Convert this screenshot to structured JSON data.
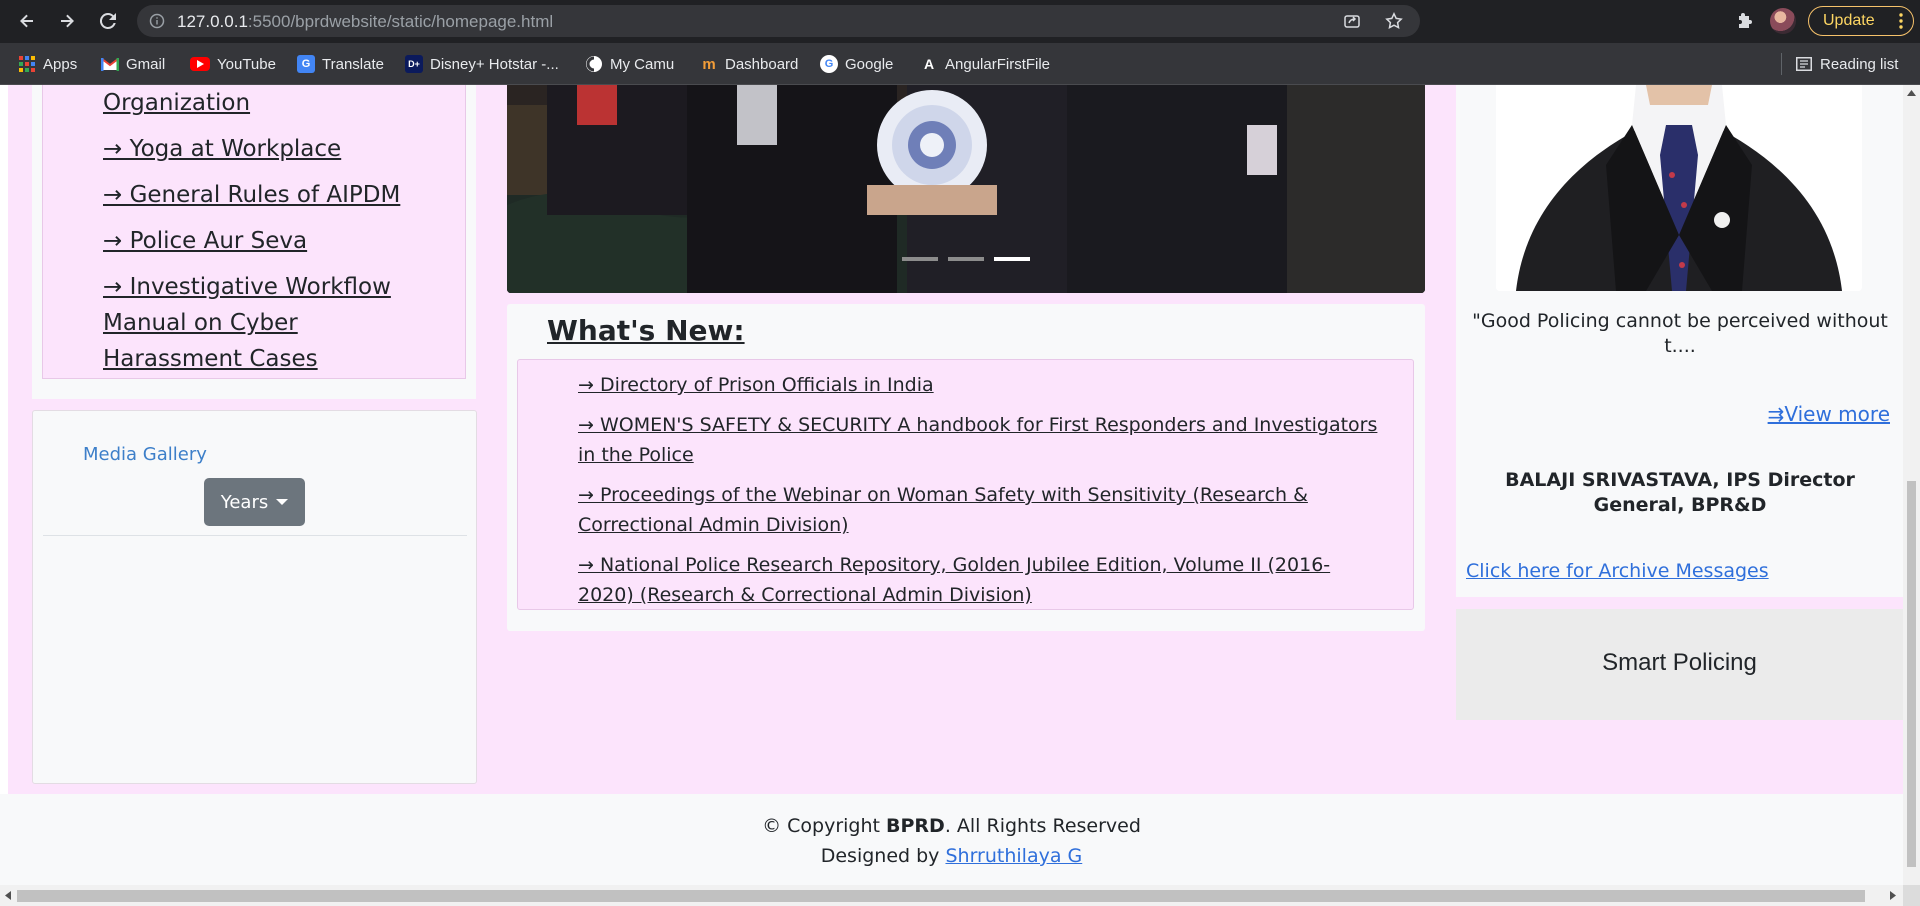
{
  "browser": {
    "url_host": "127.0.0.1",
    "url_rest": ":5500/bprdwebsite/static/homepage.html",
    "update_label": "Update",
    "bookmarks": [
      {
        "label": "Apps",
        "icon": "apps-grid-icon"
      },
      {
        "label": "Gmail",
        "icon": "gmail-icon"
      },
      {
        "label": "YouTube",
        "icon": "youtube-icon"
      },
      {
        "label": "Translate",
        "icon": "translate-icon"
      },
      {
        "label": "Disney+ Hotstar -...",
        "icon": "hotstar-icon"
      },
      {
        "label": "My Camu",
        "icon": "camu-icon"
      },
      {
        "label": "Dashboard",
        "icon": "dashboard-icon"
      },
      {
        "label": "Google",
        "icon": "google-icon"
      },
      {
        "label": "AngularFirstFile",
        "icon": "angular-icon"
      }
    ],
    "reading_list": "Reading list"
  },
  "left_links": [
    "Organization",
    "→ Yoga at Workplace",
    "→ General Rules of AIPDM",
    "→ Police Aur Seva",
    "→ Investigative Workflow Manual on Cyber Harassment Cases"
  ],
  "media": {
    "title": "Media Gallery",
    "years_label": "Years"
  },
  "whats_new": {
    "title": "What's New:",
    "items": [
      "→ Directory of Prison Officials in India",
      "→ WOMEN'S SAFETY & SECURITY A handbook for First Responders and Investigators in the Police",
      "→ Proceedings of the Webinar on Woman Safety with Sensitivity (Research & Correctional Admin Division)",
      "→ National Police Research Repository, Golden Jubilee Edition, Volume II (2016-2020) (Research & Correctional Admin Division)"
    ]
  },
  "director": {
    "quote": "\"Good Policing cannot be perceived without t....",
    "view_more": "⇉View more",
    "name": "BALAJI SRIVASTAVA, IPS Director General, BPR&D",
    "archive": "Click here for Archive Messages"
  },
  "smart_policing": "Smart Policing",
  "footer": {
    "copyright_pre": "© Copyright ",
    "brand": "BPRD",
    "copyright_post": ". All Rights Reserved",
    "designed_by": "Designed by ",
    "designer": "Shrruthilaya G"
  },
  "colors": {
    "page_pink": "#fce4fc",
    "link_blue": "#2f6fdb",
    "years_button": "#6c757d"
  }
}
